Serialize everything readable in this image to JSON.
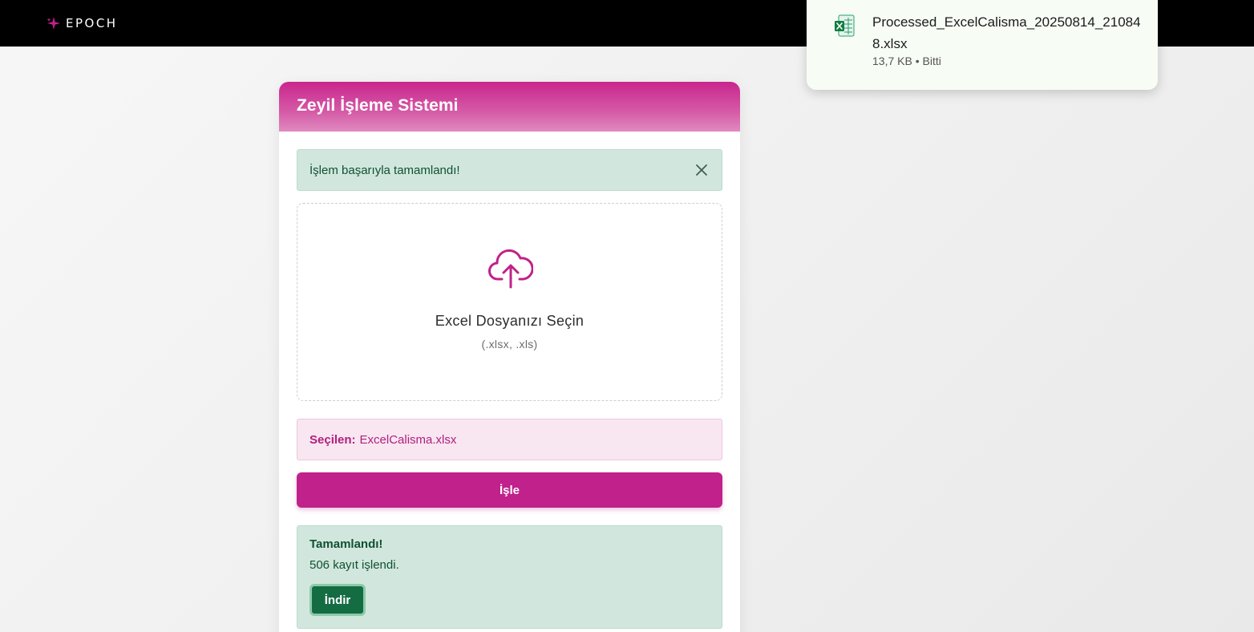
{
  "brand": {
    "logo_text": "EPOCH",
    "accent": "#c0218a"
  },
  "card": {
    "title": "Zeyil İşleme Sistemi",
    "success_alert": "İşlem başarıyla tamamlandı!",
    "dropzone": {
      "icon": "cloud-upload-icon",
      "title": "Excel Dosyanızı Seçin",
      "subtitle": "(.xlsx, .xls)"
    },
    "selected": {
      "label": "Seçilen:",
      "filename": "ExcelCalisma.xlsx"
    },
    "process_button": "İşle",
    "result": {
      "title": "Tamamlandı!",
      "message": "506 kayıt işlendi.",
      "download_button": "İndir"
    }
  },
  "download_popup": {
    "icon": "excel-file-icon",
    "filename": "Processed_ExcelCalisma_20250814_210848.xlsx",
    "meta": "13,7 KB • Bitti"
  }
}
